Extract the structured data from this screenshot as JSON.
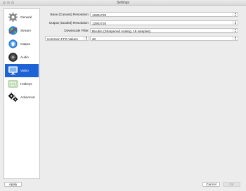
{
  "window": {
    "title": "Settings"
  },
  "sidebar": {
    "items": [
      {
        "label": "General",
        "icon": "gear-icon"
      },
      {
        "label": "Stream",
        "icon": "globe-icon"
      },
      {
        "label": "Output",
        "icon": "output-icon"
      },
      {
        "label": "Audio",
        "icon": "speaker-icon"
      },
      {
        "label": "Video",
        "icon": "monitor-icon"
      },
      {
        "label": "Hotkeys",
        "icon": "keyboard-icon"
      },
      {
        "label": "Advanced",
        "icon": "gears-icon"
      }
    ],
    "selected": "Video"
  },
  "video": {
    "base_resolution": {
      "label": "Base (Canvas) Resolution",
      "value": "1280x720"
    },
    "output_resolution": {
      "label": "Output (Scaled) Resolution",
      "value": "1280x720"
    },
    "downscale_filter": {
      "label": "Downscale Filter",
      "value": "Bicubic (Sharpened scaling, 16 samples)"
    },
    "fps": {
      "type_value": "Common FPS Values",
      "value": "30"
    }
  },
  "buttons": {
    "apply": "Apply",
    "cancel": "Cancel",
    "ok": "OK"
  },
  "colors": {
    "accent": "#1d63d6",
    "background": "#ececec"
  }
}
